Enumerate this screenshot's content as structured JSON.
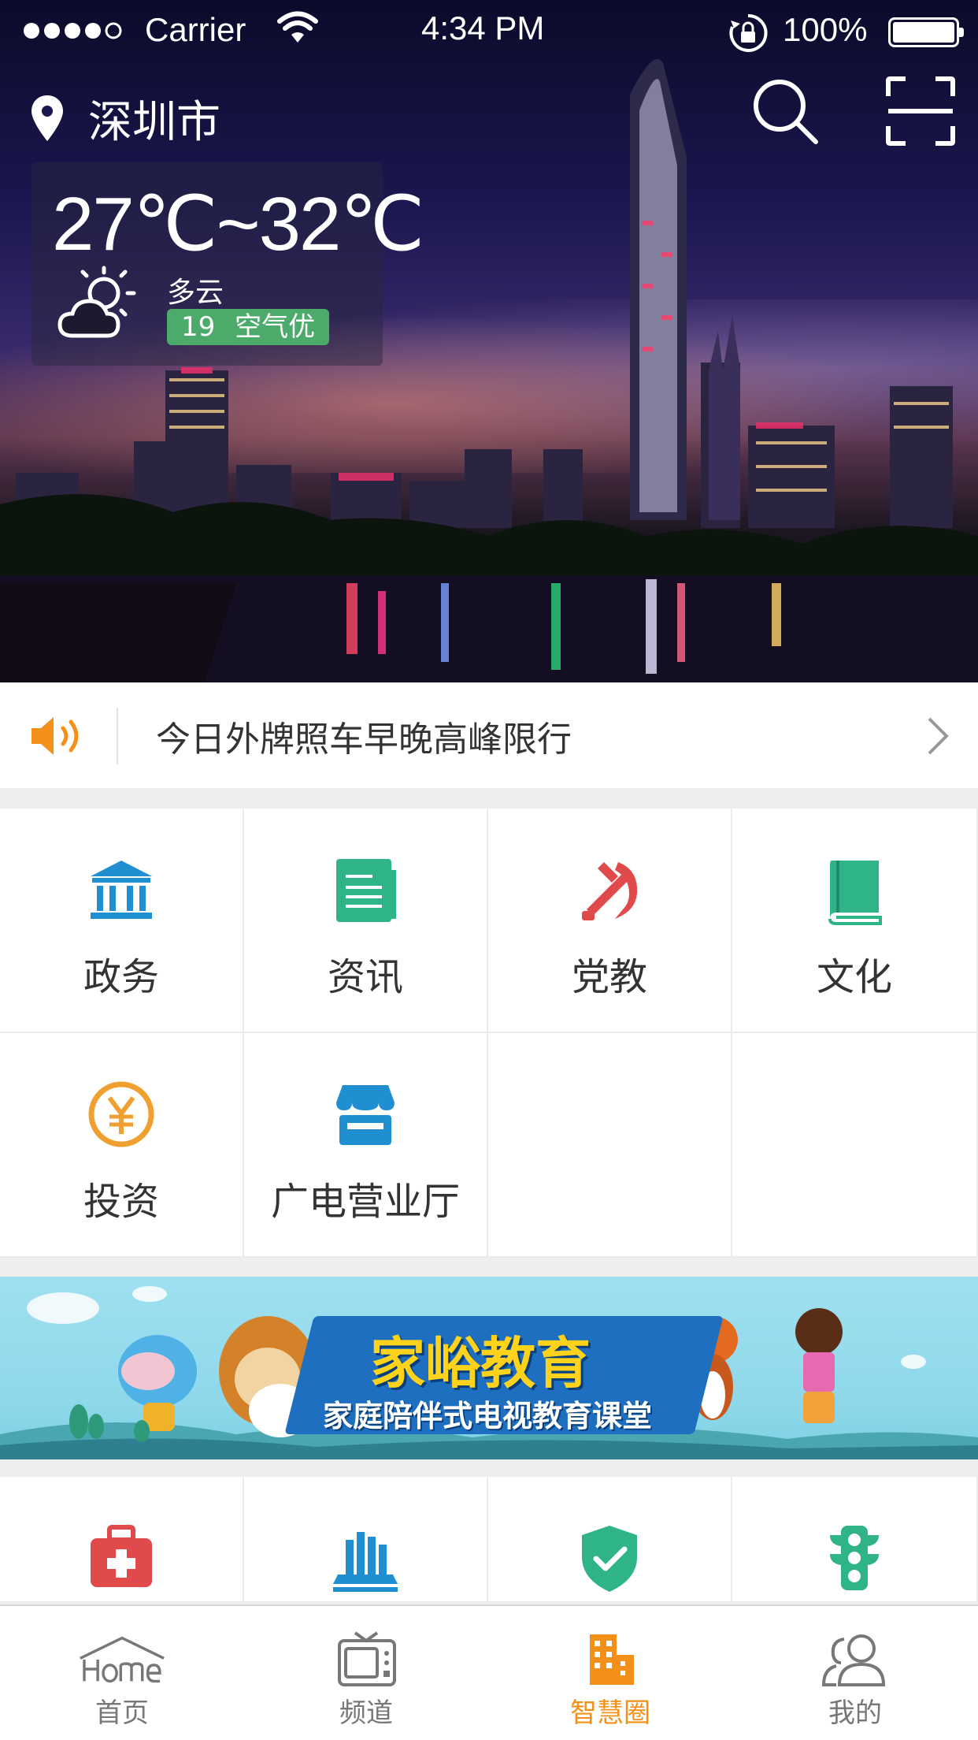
{
  "status_bar": {
    "carrier": "Carrier",
    "time": "4:34 PM",
    "battery_pct": "100%"
  },
  "header": {
    "city": "深圳市",
    "icons": [
      "location-pin-icon",
      "search-icon",
      "scan-icon"
    ]
  },
  "weather": {
    "temp_range": "27℃~32℃",
    "condition": "多云",
    "aqi_value": "19",
    "aqi_label": "空气优"
  },
  "notice": {
    "text": "今日外牌照车早晚高峰限行"
  },
  "services": [
    {
      "label": "政务",
      "icon": "government-building-icon",
      "color": "#1f8fd2"
    },
    {
      "label": "资讯",
      "icon": "news-document-icon",
      "color": "#2fb48a"
    },
    {
      "label": "党教",
      "icon": "party-emblem-icon",
      "color": "#e04a4a"
    },
    {
      "label": "文化",
      "icon": "book-icon",
      "color": "#2fb48a"
    },
    {
      "label": "投资",
      "icon": "yuan-coin-icon",
      "color": "#f0a030"
    },
    {
      "label": "广电营业厅",
      "icon": "storefront-icon",
      "color": "#1f8fd2"
    }
  ],
  "banner": {
    "title": "家峪教育",
    "subtitle": "家庭陪伴式电视教育课堂"
  },
  "services_row2": [
    {
      "icon": "medical-kit-icon",
      "color": "#e04a4a"
    },
    {
      "icon": "library-books-icon",
      "color": "#1f8fd2"
    },
    {
      "icon": "shield-check-icon",
      "color": "#2fb48a"
    },
    {
      "icon": "traffic-light-icon",
      "color": "#2fb48a"
    }
  ],
  "tabbar": {
    "tabs": [
      {
        "label": "首页",
        "icon": "home-icon"
      },
      {
        "label": "频道",
        "icon": "tv-icon"
      },
      {
        "label": "智慧圈",
        "icon": "city-buildings-icon"
      },
      {
        "label": "我的",
        "icon": "users-icon"
      }
    ],
    "active_index": 2,
    "active_color": "#f29019",
    "inactive_color": "#777777"
  }
}
